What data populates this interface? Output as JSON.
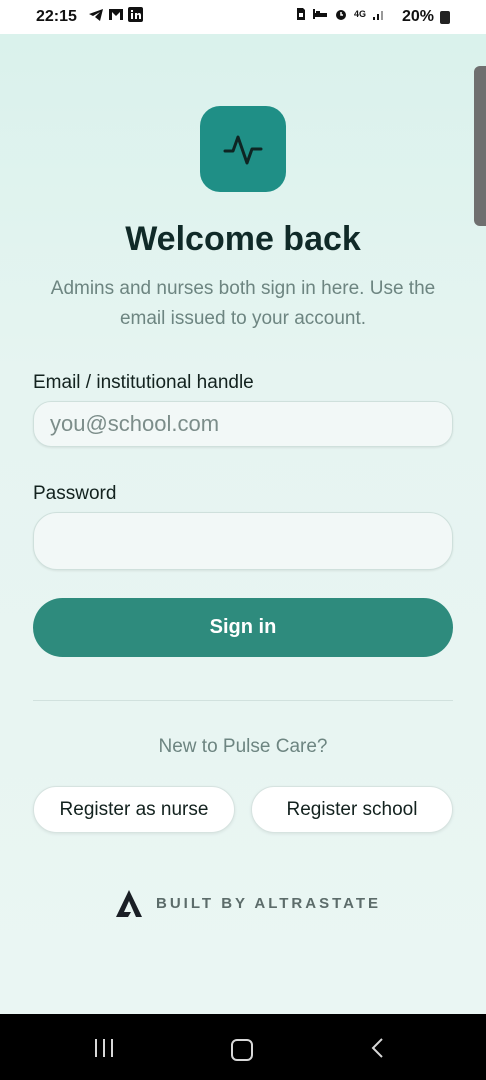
{
  "status_bar": {
    "time": "22:15",
    "network": "4G",
    "battery": "20%"
  },
  "login": {
    "title": "Welcome back",
    "subtitle": "Admins and nurses both sign in here. Use the email issued to your account.",
    "email_label": "Email / institutional handle",
    "email_placeholder": "you@school.com",
    "email_value": "",
    "password_label": "Password",
    "password_value": "",
    "sign_in_label": "Sign in"
  },
  "register": {
    "prompt": "New to Pulse Care?",
    "nurse_label": "Register as nurse",
    "school_label": "Register school"
  },
  "footer": {
    "built_by": "BUILT BY ALTRASTATE"
  },
  "icons": {
    "app_logo": "pulse-icon",
    "brand": "altrastate-logo-icon"
  },
  "colors": {
    "accent": "#2e8b7d",
    "logo_bg": "#1f8f86",
    "title": "#102a28",
    "muted": "#6d8581"
  }
}
